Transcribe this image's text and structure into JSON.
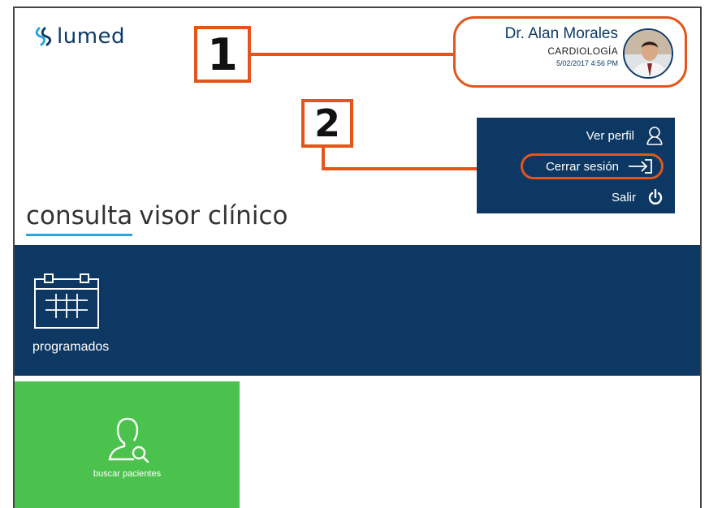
{
  "logo": {
    "text": "lumed",
    "icon": "lumed-logo-icon"
  },
  "user": {
    "name": "Dr. Alan Morales",
    "specialty": "CARDIOLOGÍA",
    "datetime": "5/02/2017 4:56 PM"
  },
  "callouts": {
    "one": "1",
    "two": "2"
  },
  "menu": {
    "profile": "Ver perfil",
    "logout": "Cerrar sesión",
    "exit": "Salir"
  },
  "title": {
    "active": "consulta",
    "rest": "visor clínico"
  },
  "tiles": {
    "scheduled": "programados",
    "search": "buscar pacientes"
  },
  "colors": {
    "navy": "#0d3863",
    "accent_orange": "#e4551b",
    "green": "#4cc24e",
    "underline_blue": "#29a6e2"
  }
}
